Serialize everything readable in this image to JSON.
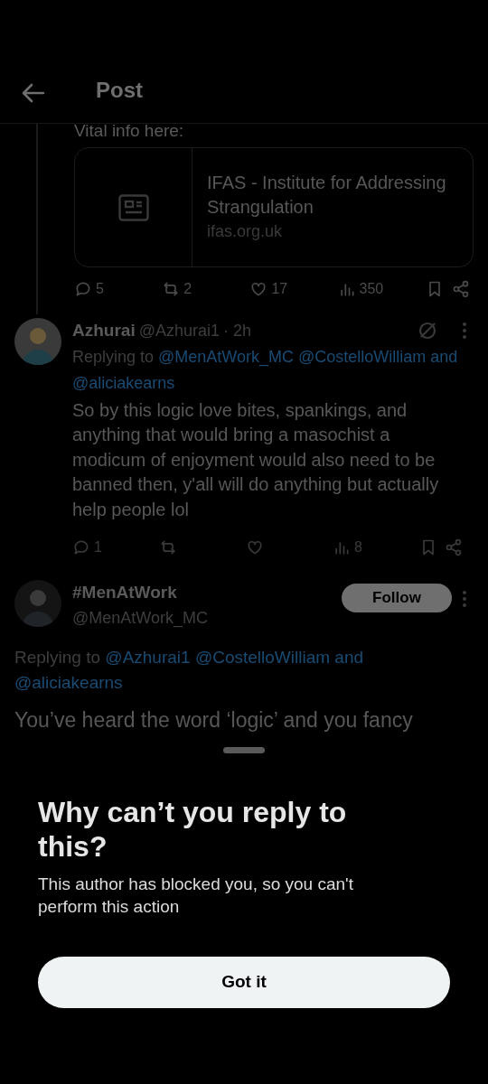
{
  "header": {
    "title": "Post"
  },
  "first_post": {
    "text_tail": "Vital info here:",
    "link_card": {
      "title": "IFAS - Institute for Addressing Strangulation",
      "domain": "ifas.org.uk"
    },
    "actions": [
      {
        "kind": "reply",
        "count": "5"
      },
      {
        "kind": "repost",
        "count": "2"
      },
      {
        "kind": "like",
        "count": "17"
      },
      {
        "kind": "views",
        "count": "350"
      },
      {
        "kind": "bookmark"
      },
      {
        "kind": "share"
      }
    ]
  },
  "reply": {
    "name": "Azhurai",
    "handle": "@Azhurai1",
    "time": "· 2h",
    "replying_label": "Replying to",
    "replying_to": "@MenAtWork_MC @CostelloWilliam and @aliciakearns",
    "text": "So by this logic love bites, spankings, and anything that would bring a masochist a modicum of enjoyment would also need to be banned then, y'all will do anything but actually help people lol",
    "actions": [
      {
        "kind": "reply",
        "count": "1"
      },
      {
        "kind": "repost"
      },
      {
        "kind": "like"
      },
      {
        "kind": "views",
        "count": "8"
      },
      {
        "kind": "bookmark"
      },
      {
        "kind": "share"
      }
    ]
  },
  "main_post": {
    "name": "#MenAtWork",
    "handle": "@MenAtWork_MC",
    "follow_label": "Follow",
    "replying_label": "Replying to",
    "replying_to": "@Azhurai1 @CostelloWilliam and @aliciakearns",
    "text": "You’ve heard the word ‘logic’ and you fancy"
  },
  "sheet": {
    "title": "Why can’t you reply to this?",
    "message": "This author has blocked you, so you can't perform this action",
    "button": "Got it"
  }
}
